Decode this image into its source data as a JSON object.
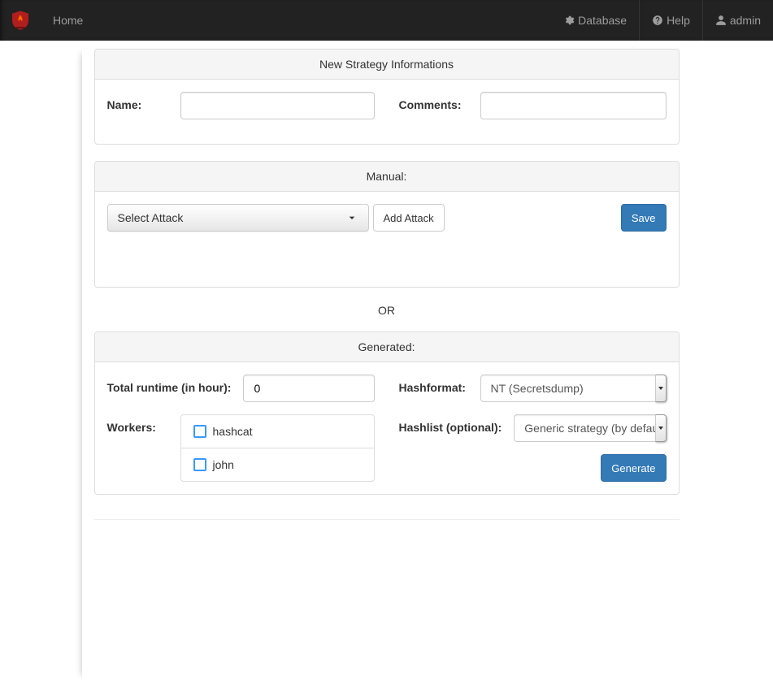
{
  "nav": {
    "home": "Home",
    "database": "Database",
    "help": "Help",
    "admin": "admin"
  },
  "panel_strategy": {
    "title": "New Strategy Informations",
    "name_label": "Name:",
    "name_value": "",
    "comments_label": "Comments:",
    "comments_value": ""
  },
  "panel_manual": {
    "title": "Manual:",
    "select_attack_label": "Select Attack",
    "add_attack_label": "Add Attack",
    "save_label": "Save"
  },
  "separator": "OR",
  "panel_generated": {
    "title": "Generated:",
    "runtime_label": "Total runtime (in hour):",
    "runtime_value": "0",
    "workers_label": "Workers:",
    "workers": [
      {
        "name": "hashcat",
        "checked": false
      },
      {
        "name": "john",
        "checked": false
      }
    ],
    "hashformat_label": "Hashformat:",
    "hashformat_value": "NT (Secretsdump)",
    "hashlist_label": "Hashlist (optional):",
    "hashlist_value": "Generic strategy (by default)",
    "generate_label": "Generate"
  }
}
